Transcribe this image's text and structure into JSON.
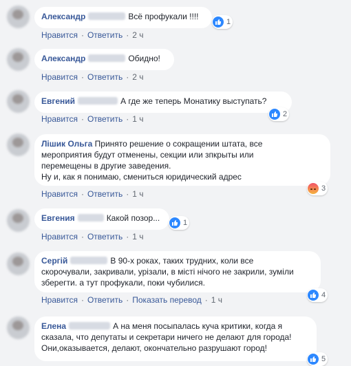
{
  "comments": [
    {
      "author": "Александр",
      "text": "Всё профукали !!!!",
      "reaction_count": "1",
      "reaction_icon": "like-icon",
      "actions": {
        "like": "Нравится",
        "reply": "Ответить",
        "time": "2 ч"
      }
    },
    {
      "author": "Александр",
      "text": "Обидно!",
      "actions": {
        "like": "Нравится",
        "reply": "Ответить",
        "time": "2 ч"
      }
    },
    {
      "author": "Евгений",
      "text": "А где же теперь Монатику выступать?",
      "reaction_count": "2",
      "reaction_icon": "like-icon",
      "actions": {
        "like": "Нравится",
        "reply": "Ответить",
        "time": "1 ч"
      }
    },
    {
      "author": "Лішик Ольга",
      "text": "Принято решение о сокращении штата, все\nмероприятия будут отменены, секции или зпкрыты или\nперемещены в другие заведения.\nНу и, как я понимаю, смениться юридический адрес",
      "reaction_count": "3",
      "reaction_icon": "angry-icon",
      "actions": {
        "like": "Нравится",
        "reply": "Ответить",
        "time": "1 ч"
      }
    },
    {
      "author": "Евгения",
      "text": "Какой позор...",
      "reaction_count": "1",
      "reaction_icon": "like-icon",
      "actions": {
        "like": "Нравится",
        "reply": "Ответить",
        "time": "1 ч"
      }
    },
    {
      "author": "Сергій",
      "text": "В 90-х роках, таких трудних, коли все\nскорочували, закривали, урізали, в місті нічого не закрили, зуміли\nзберегти. а тут профукали, поки чубилися.",
      "reaction_count": "4",
      "reaction_icon": "like-icon",
      "actions": {
        "like": "Нравится",
        "reply": "Ответить",
        "translate": "Показать перевод",
        "time": "1 ч"
      }
    },
    {
      "author": "Елена",
      "text": "А на меня посыпалась куча критики, когда я\nсказала, что депутаты и секретари ничего не делают для города!\nОни,оказывается, делают, окончательно разрушают город!",
      "reaction_count": "5",
      "reaction_icon": "like-icon"
    }
  ],
  "colors": {
    "background": "#f2f3f5",
    "bubble": "#ffffff",
    "author": "#385898",
    "meta": "#606770",
    "like": "#2d88ff"
  }
}
